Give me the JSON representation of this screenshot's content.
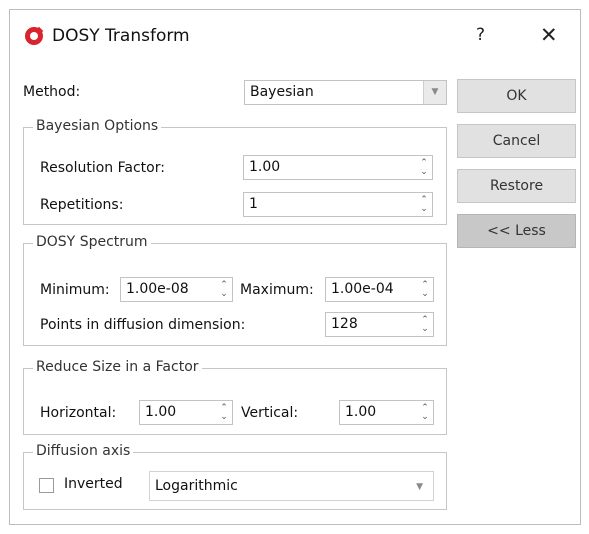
{
  "window": {
    "title": "DOSY Transform",
    "help_label": "?",
    "close_label": "✕",
    "app_icon": "mestrenova-logo-icon"
  },
  "method": {
    "label": "Method:",
    "value": "Bayesian"
  },
  "bayesian": {
    "legend": "Bayesian Options",
    "resolution_label": "Resolution Factor:",
    "resolution_value": "1.00",
    "repetitions_label": "Repetitions:",
    "repetitions_value": "1"
  },
  "spectrum": {
    "legend": "DOSY Spectrum",
    "minimum_label": "Minimum:",
    "minimum_value": "1.00e-08",
    "maximum_label": "Maximum:",
    "maximum_value": "1.00e-04",
    "points_label": "Points in diffusion dimension:",
    "points_value": "128"
  },
  "reduce": {
    "legend": "Reduce Size in a Factor",
    "horizontal_label": "Horizontal:",
    "horizontal_value": "1.00",
    "vertical_label": "Vertical:",
    "vertical_value": "1.00"
  },
  "axis": {
    "legend": "Diffusion axis",
    "inverted_label": "Inverted",
    "inverted_checked": false,
    "scale_value": "Logarithmic"
  },
  "buttons": {
    "ok": "OK",
    "cancel": "Cancel",
    "restore": "Restore",
    "less": "<< Less"
  },
  "glyphs": {
    "spin_up": "⌃",
    "spin_down": "⌄",
    "dropdown": "▼"
  },
  "colors": {
    "accent_red": "#d9232d",
    "button_bg": "#e1e1e1",
    "active_button_bg": "#c8c8c8"
  }
}
